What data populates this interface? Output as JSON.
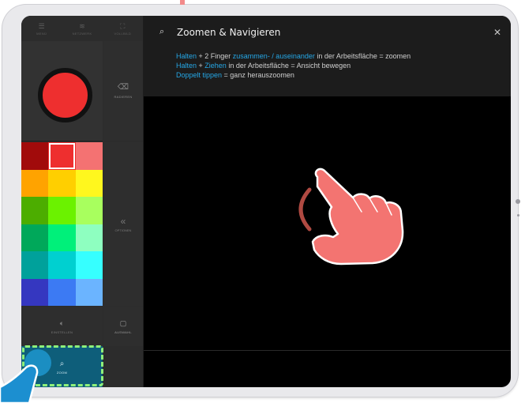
{
  "nav": [
    {
      "icon": "menu-icon",
      "glyph": "☰",
      "label": "MENÜ"
    },
    {
      "icon": "network-icon",
      "glyph": "≋",
      "label": "NETZWERK"
    },
    {
      "icon": "fullscreen-icon",
      "glyph": "⛶",
      "label": "VOLLBILD"
    }
  ],
  "tool": {
    "current_color": "#ee2f2f",
    "erase_label": "RADIEREN",
    "erase_icon": "eraser-icon"
  },
  "palette": [
    "#a10b0b",
    "#ee2f2f",
    "#f47272",
    "#ffa300",
    "#ffcf00",
    "#fff71e",
    "#4cad00",
    "#6bf200",
    "#a8ff5e",
    "#00a85a",
    "#00f07a",
    "#8effc0",
    "#00a19b",
    "#00d0d0",
    "#36ffff",
    "#3537c0",
    "#3c7af3",
    "#6bb4ff"
  ],
  "selected_color_index": 1,
  "more": {
    "label": "OPTIONEN"
  },
  "buttons": {
    "volume_label": "EINSTELLEN",
    "select_label": "AUSWAHL",
    "zoom_label": "ZOOM"
  },
  "hint": {
    "title": "Zoomen & Navigieren",
    "line1": {
      "a": "Halten",
      "b": " + 2 Finger ",
      "c": "zusammen- / auseinander",
      "d": " in der Arbeitsfläche = zoomen"
    },
    "line2": {
      "a": "Halten",
      "b": " + ",
      "c": "Ziehen",
      "d": " in der Arbeitsfläche = Ansicht bewegen"
    },
    "line3": {
      "a": "Doppelt tippen",
      "b": " = ganz herauszoomen"
    }
  }
}
